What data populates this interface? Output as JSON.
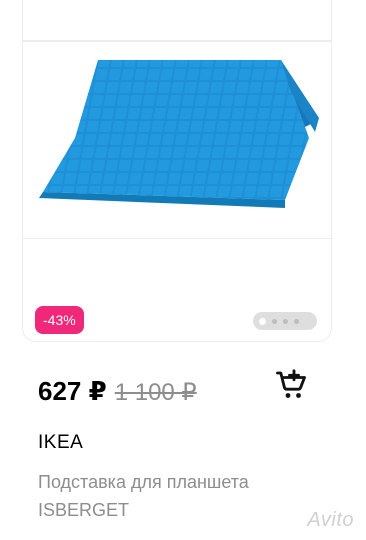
{
  "product": {
    "discount_badge": "-43%",
    "price_current": "627 ₽",
    "price_old": "1 100 ₽",
    "seller": "IKEA",
    "title": "Подставка для планшета ISBERGET",
    "image_icon": "tablet-stand-image",
    "cart_icon": "cart-icon",
    "gallery": {
      "total": 4,
      "active": 1
    }
  },
  "watermark": "Avito",
  "colors": {
    "badge": "#f0287a",
    "product": "#1e90d6",
    "muted_text": "#8d8d8d"
  }
}
